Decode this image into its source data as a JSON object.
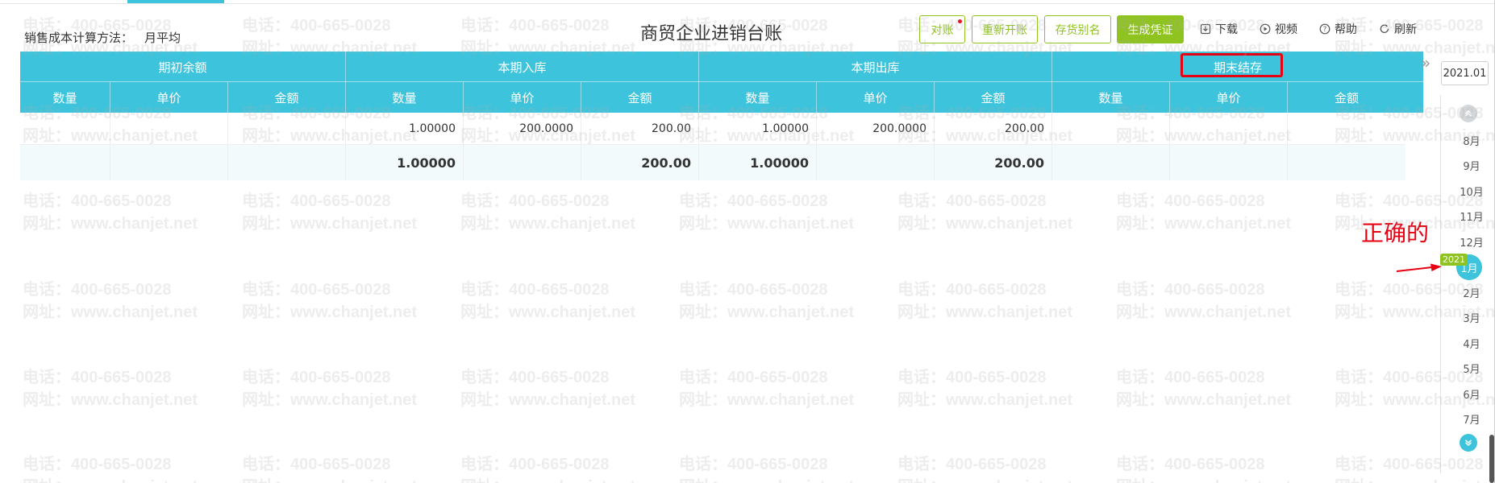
{
  "app": {
    "title": "商贸企业进销台账",
    "cost_method_label": "销售成本计算方法：",
    "cost_method_value": "月平均"
  },
  "toolbar": {
    "reconcile": "对账",
    "reopen": "重新开账",
    "alias": "存货别名",
    "generate_voucher": "生成凭证",
    "download": "下载",
    "video": "视频",
    "help": "帮助",
    "refresh": "刷新"
  },
  "colors": {
    "header_bg": "#3dc4dc",
    "accent_green": "#8fc31f",
    "highlight_red": "#e60012",
    "total_row_bg": "#f2fafc"
  },
  "table": {
    "groups": [
      "期初余额",
      "本期入库",
      "本期出库",
      "期末结存"
    ],
    "columns": [
      "数量",
      "单价",
      "金额",
      "数量",
      "单价",
      "金额",
      "数量",
      "单价",
      "金额",
      "数量",
      "单价",
      "金额"
    ],
    "rows": [
      [
        "",
        "",
        "",
        "1.00000",
        "200.0000",
        "200.00",
        "1.00000",
        "200.0000",
        "200.00",
        "",
        "",
        ""
      ]
    ],
    "total": [
      "",
      "",
      "",
      "1.00000",
      "",
      "200.00",
      "1.00000",
      "",
      "200.00",
      "",
      "",
      ""
    ]
  },
  "watermark": {
    "line1": "电话：400-665-0028",
    "line2": "网址：www.chanjet.net"
  },
  "sidebar": {
    "period": "2021.01",
    "year_badge": "2021",
    "active_month": "1月",
    "months_before": [
      "8月",
      "9月",
      "10月",
      "11月",
      "12月"
    ],
    "months_after": [
      "2月",
      "3月",
      "4月",
      "5月",
      "6月",
      "7月"
    ]
  },
  "annotation": {
    "text": "正确的"
  }
}
